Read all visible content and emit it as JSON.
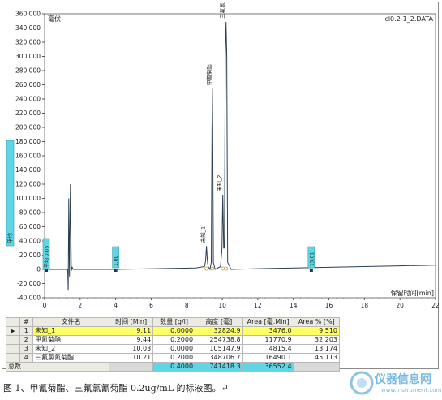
{
  "chart": {
    "top_left_label": "毫伏",
    "file_label": "cl0.2-1_2.DATA",
    "xlabel": "保留时间[min]",
    "y_ticks": [
      "360,000",
      "340,000",
      "320,000",
      "300,000",
      "280,000",
      "260,000",
      "240,000",
      "220,000",
      "200,000",
      "180,000",
      "160,000",
      "140,000",
      "120,000",
      "100,000",
      "80,000",
      "60,000",
      "40,000",
      "20,000",
      "0",
      "-20,000",
      "-40,000"
    ],
    "x_ticks": [
      "0",
      "2",
      "4",
      "6",
      "8",
      "10",
      "12",
      "14",
      "16",
      "18",
      "20",
      "22"
    ],
    "peak_labels": [
      "未知_1",
      "甲氰菊酯",
      "未知_2",
      "三氟氯氰菊酯"
    ],
    "event_markers": [
      "平均 0.05",
      "1.00",
      "15.01"
    ],
    "left_marker": "平均",
    "colors": {
      "trace": "#2c3e50",
      "marker": "#5fd6e6",
      "selection": "#ffff66"
    }
  },
  "chart_data": {
    "type": "line",
    "xlabel": "保留时间[min]",
    "ylabel": "",
    "xlim": [
      0,
      22
    ],
    "ylim": [
      -40000,
      360000
    ],
    "series": [
      {
        "x": [
          0,
          1.3,
          1.33,
          1.36,
          1.4,
          1.45,
          1.5,
          1.55,
          1.6,
          1.7,
          2,
          4,
          8.5,
          9.0,
          9.06,
          9.11,
          9.16,
          9.2,
          9.3,
          9.38,
          9.42,
          9.44,
          9.46,
          9.5,
          9.6,
          9.9,
          9.98,
          10.03,
          10.08,
          10.12,
          10.17,
          10.21,
          10.25,
          10.3,
          10.5,
          12,
          16,
          20,
          22
        ],
        "y": [
          0,
          0,
          -30000,
          100000,
          -10000,
          120000,
          -2000,
          3000,
          0,
          0,
          0,
          0,
          2000,
          4000,
          12000,
          32800,
          12000,
          4000,
          0,
          10000,
          200000,
          254700,
          200000,
          10000,
          0,
          4000,
          30000,
          105100,
          30000,
          30000,
          300000,
          348700,
          300000,
          10000,
          0,
          1000,
          3000,
          5000,
          6000
        ]
      }
    ]
  },
  "table": {
    "headers": [
      "#",
      "文件名",
      "时间 [Min]",
      "数量 [g/l]",
      "高度 [毫]",
      "Area [毫.Min]",
      "Area % [%]"
    ],
    "rows": [
      {
        "idx": "1",
        "name": "未知_1",
        "time": "9.11",
        "amount": "0.0000",
        "height": "32824.9",
        "area": "3476.0",
        "pct": "9.510"
      },
      {
        "idx": "2",
        "name": "甲氰菊酯",
        "time": "9.44",
        "amount": "0.2000",
        "height": "254738.8",
        "area": "11770.9",
        "pct": "32.203"
      },
      {
        "idx": "3",
        "name": "未知_2",
        "time": "10.03",
        "amount": "0.0000",
        "height": "105147.9",
        "area": "4815.4",
        "pct": "13.174"
      },
      {
        "idx": "4",
        "name": "三氟氯氰菊酯",
        "time": "10.21",
        "amount": "0.2000",
        "height": "348706.7",
        "area": "16490.1",
        "pct": "45.113"
      }
    ],
    "total": {
      "label": "总数",
      "amount": "0.4000",
      "height": "741418.3",
      "area": "36552.4"
    }
  },
  "caption": "图 1、甲氰菊酯、三氟氯氰菊酯 0.2ug/mL 的标液图。↵",
  "watermark": {
    "text": "仪器信息网",
    "url": "www.instrument.com.cn"
  }
}
